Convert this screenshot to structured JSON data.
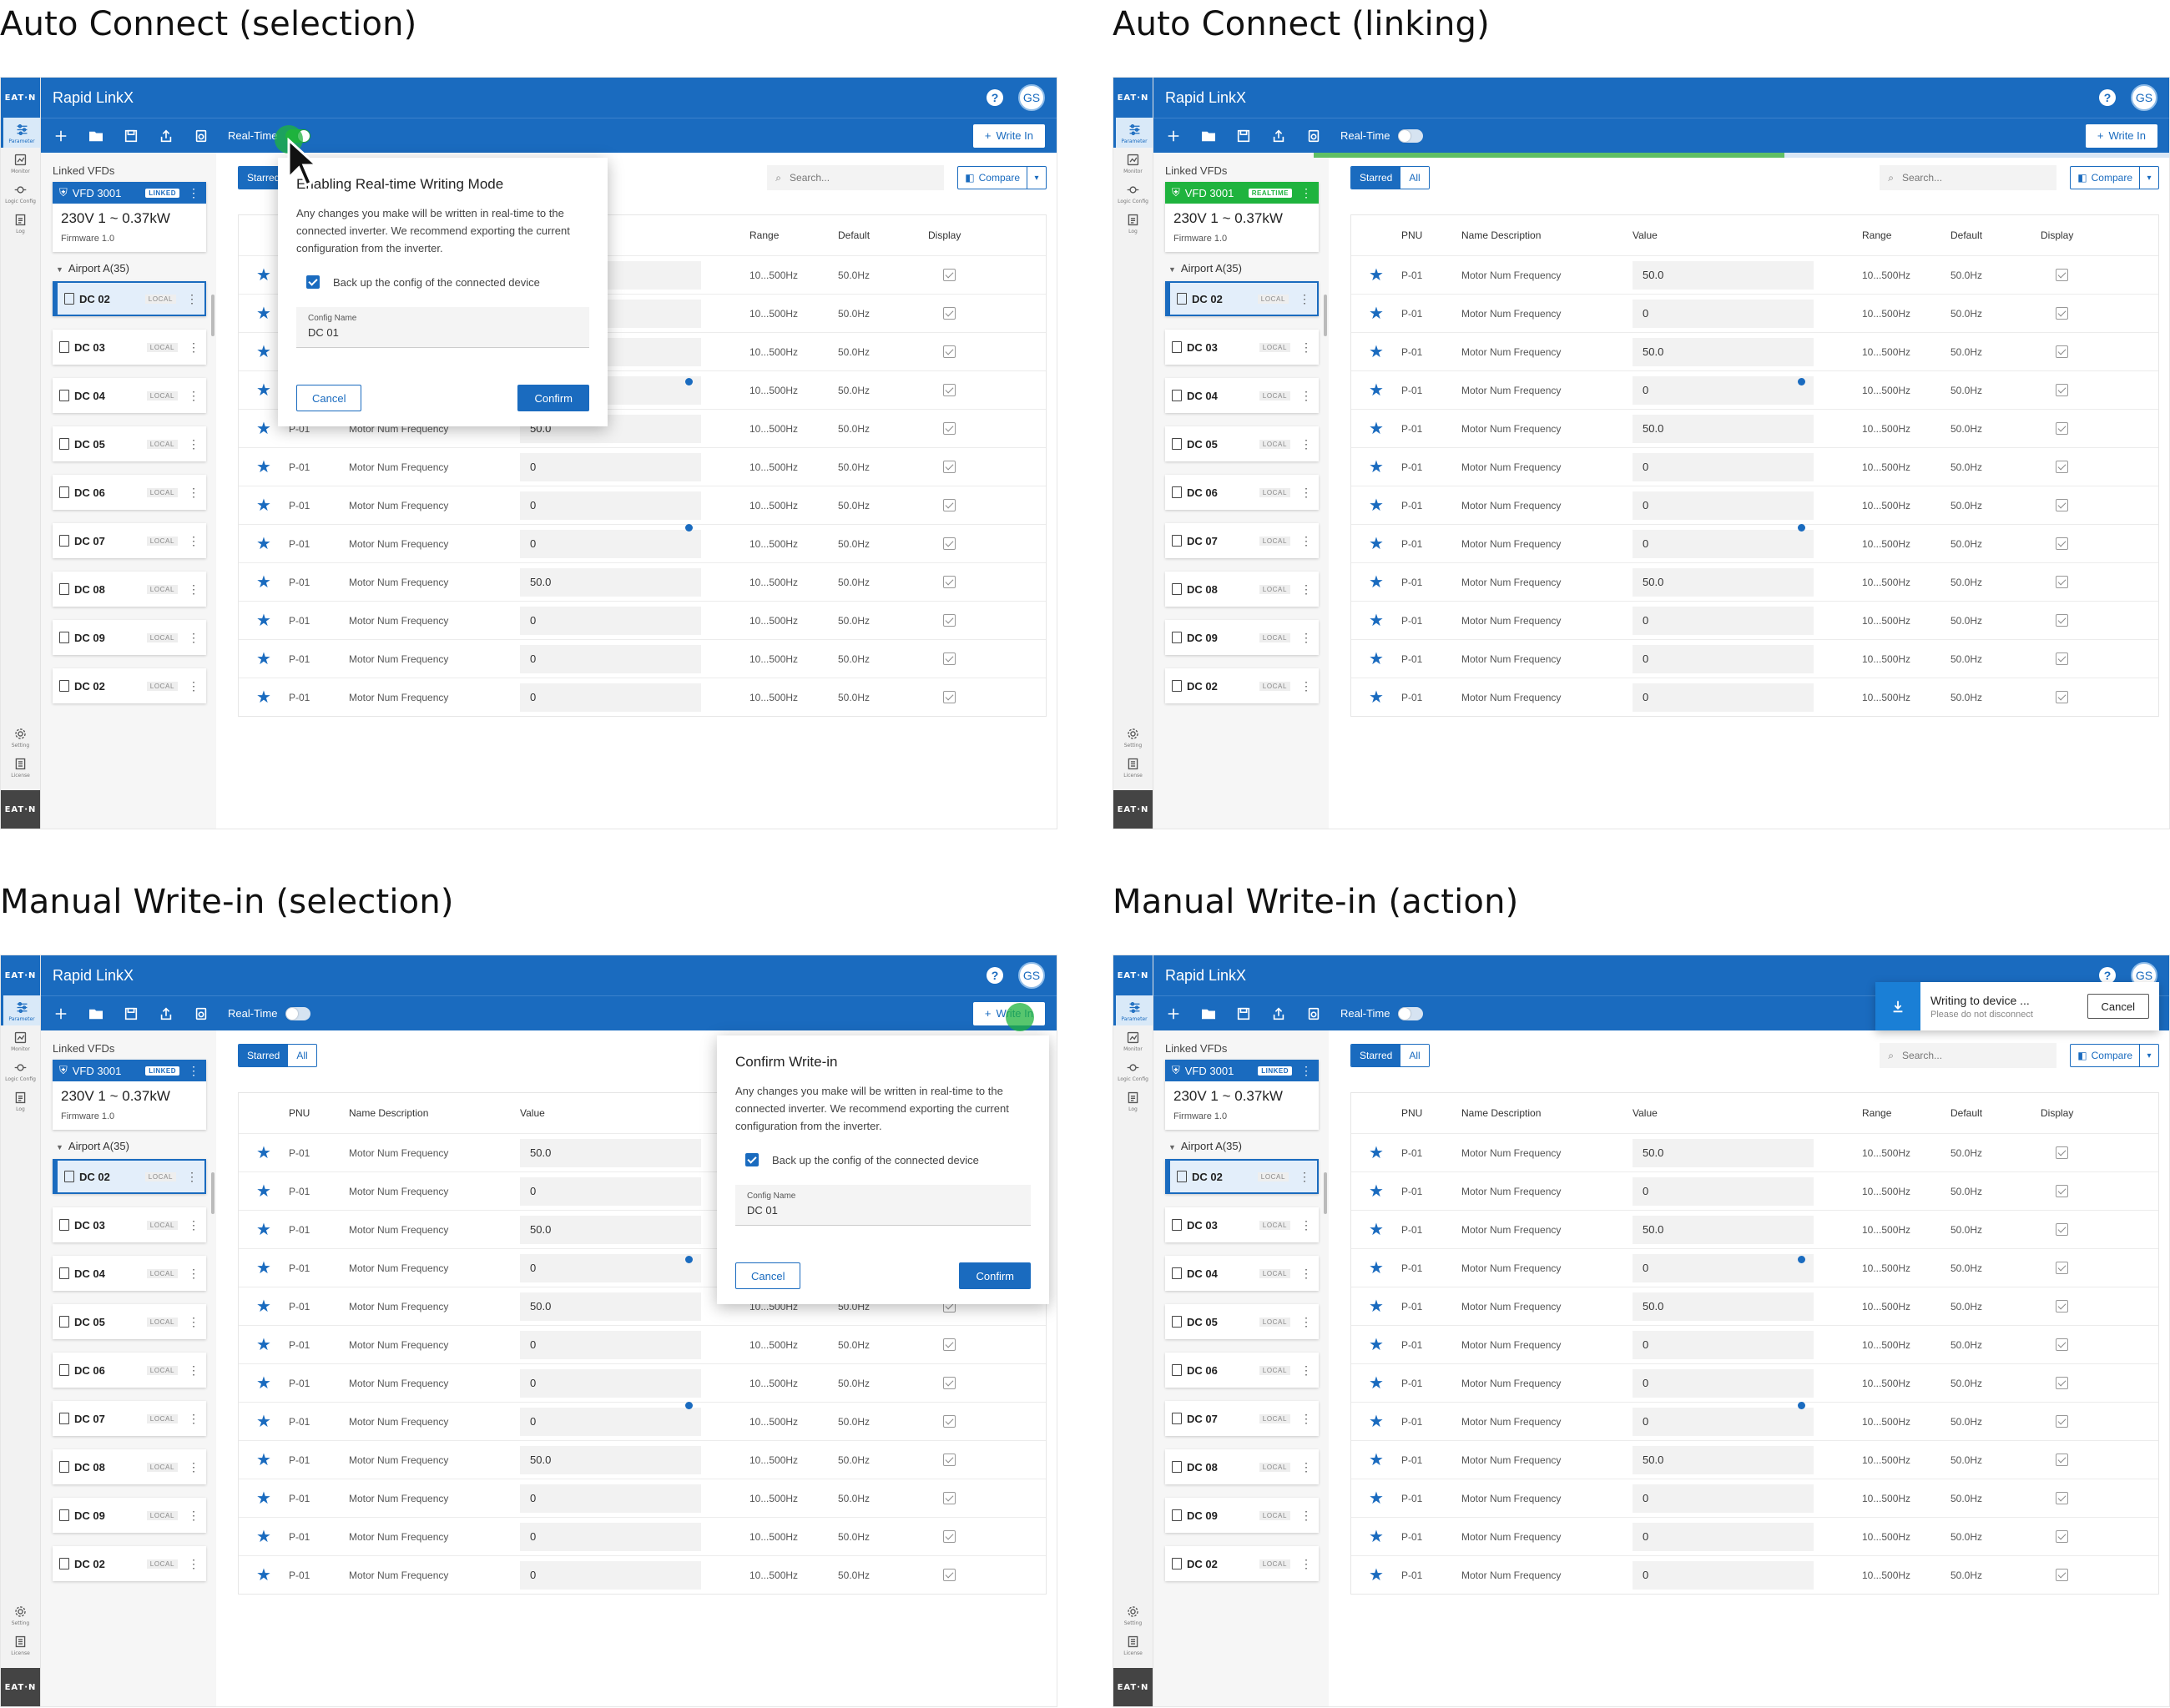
{
  "titles": {
    "tl": "Auto Connect (selection)",
    "tr": "Auto Connect (linking)",
    "bl": "Manual Write-in (selection)",
    "br": "Manual Write-in (action)"
  },
  "app": {
    "name": "Rapid LinkX",
    "avatar": "GS",
    "help": "?",
    "realtime_label": "Real-Time",
    "write_in_label": "Write In",
    "brand": "EAT·N"
  },
  "rail": {
    "items": [
      {
        "label": "Parameter",
        "icon": "sliders-icon"
      },
      {
        "label": "Monitor",
        "icon": "monitor-icon"
      },
      {
        "label": "Logic Config",
        "icon": "logic-icon"
      },
      {
        "label": "Log",
        "icon": "log-icon"
      }
    ],
    "bottom": [
      {
        "label": "Setting",
        "icon": "gear-icon"
      },
      {
        "label": "License",
        "icon": "license-icon"
      }
    ]
  },
  "sidebar": {
    "title": "Linked VFDs",
    "vfd": {
      "name": "VFD 3001",
      "badge_linked": "LINKED",
      "badge_realtime": "REALTIME",
      "spec": "230V 1 ~  0.37kW",
      "firmware": "Firmware 1.0"
    },
    "group": "Airport A(35)",
    "local_badge": "LOCAL",
    "items": [
      "DC 02",
      "DC 03",
      "DC 04",
      "DC 05",
      "DC 06",
      "DC 07",
      "DC 08",
      "DC 09",
      "DC 02"
    ]
  },
  "main": {
    "seg_starred": "Starred",
    "seg_all": "All",
    "search_placeholder": "Search...",
    "compare_label": "Compare",
    "columns": {
      "pnu": "PNU",
      "name": "Name Description",
      "value": "Value",
      "range": "Range",
      "default": "Default",
      "display": "Display"
    },
    "rows": [
      {
        "pnu": "P-01",
        "name": "Motor Num Frequency",
        "value": "50.0",
        "range": "10...500Hz",
        "default": "50.0Hz"
      },
      {
        "pnu": "P-01",
        "name": "Motor Num Frequency",
        "value": "0",
        "range": "10...500Hz",
        "default": "50.0Hz"
      },
      {
        "pnu": "P-01",
        "name": "Motor Num Frequency",
        "value": "50.0",
        "range": "10...500Hz",
        "default": "50.0Hz"
      },
      {
        "pnu": "P-01",
        "name": "Motor Num Frequency",
        "value": "0",
        "range": "10...500Hz",
        "default": "50.0Hz"
      },
      {
        "pnu": "P-01",
        "name": "Motor Num Frequency",
        "value": "50.0",
        "range": "10...500Hz",
        "default": "50.0Hz"
      },
      {
        "pnu": "P-01",
        "name": "Motor Num Frequency",
        "value": "0",
        "range": "10...500Hz",
        "default": "50.0Hz"
      },
      {
        "pnu": "P-01",
        "name": "Motor Num Frequency",
        "value": "0",
        "range": "10...500Hz",
        "default": "50.0Hz"
      },
      {
        "pnu": "P-01",
        "name": "Motor Num Frequency",
        "value": "0",
        "range": "10...500Hz",
        "default": "50.0Hz"
      },
      {
        "pnu": "P-01",
        "name": "Motor Num Frequency",
        "value": "50.0",
        "range": "10...500Hz",
        "default": "50.0Hz"
      },
      {
        "pnu": "P-01",
        "name": "Motor Num Frequency",
        "value": "0",
        "range": "10...500Hz",
        "default": "50.0Hz"
      },
      {
        "pnu": "P-01",
        "name": "Motor Num Frequency",
        "value": "0",
        "range": "10...500Hz",
        "default": "50.0Hz"
      },
      {
        "pnu": "P-01",
        "name": "Motor Num Frequency",
        "value": "0",
        "range": "10...500Hz",
        "default": "50.0Hz"
      }
    ]
  },
  "modal_realtime": {
    "title": "Enabling Real-time Writing Mode",
    "body": "Any changes you make will be written in real-time to the connected inverter. We recommend exporting the current configuration from the inverter.",
    "checkbox": "Back up the config of the connected device",
    "config_label": "Config Name",
    "config_value": "DC 01",
    "cancel": "Cancel",
    "confirm": "Confirm"
  },
  "modal_writein": {
    "title": "Confirm Write-in",
    "body": "Any changes you make will be written in real-time to the connected inverter. We recommend exporting the current configuration from the inverter.",
    "checkbox": "Back up the config of the connected device",
    "config_label": "Config Name",
    "config_value": "DC 01",
    "cancel": "Cancel",
    "confirm": "Confirm"
  },
  "toast": {
    "title": "Writing to device  ...",
    "subtitle": "Please do not disconnect",
    "cancel": "Cancel"
  },
  "linking_progress": 0.55,
  "colors": {
    "brand": "#1a6bbf",
    "realtime": "#1fb33e"
  }
}
